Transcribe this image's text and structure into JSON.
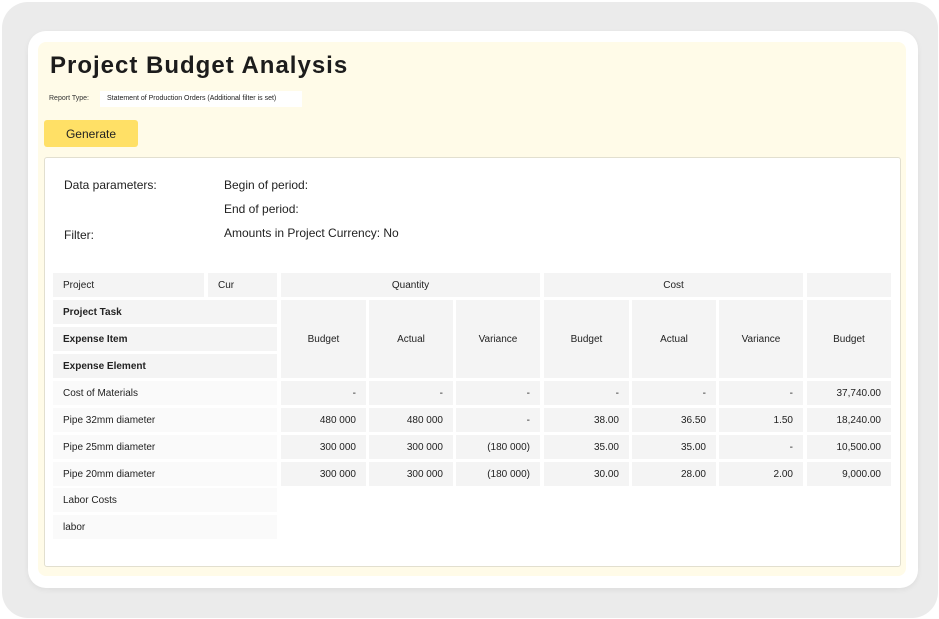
{
  "title": "Project Budget Analysis",
  "report_type": {
    "label": "Report Type:",
    "value": "Statement of Production Orders (Additional filter is set)"
  },
  "generate_label": "Generate",
  "parameters": {
    "data_parameters_label": "Data parameters:",
    "begin_label": "Begin of period:",
    "end_label": "End of period:",
    "filter_label": "Filter:",
    "amounts_label": "Amounts in Project Currency: No"
  },
  "table": {
    "header": {
      "project": "Project",
      "cur": "Cur",
      "quantity": "Quantity",
      "cost": "Cost",
      "extra": "",
      "project_task": "Project Task",
      "expense_item": "Expense Item",
      "expense_element": "Expense Element",
      "q_budget": "Budget",
      "q_actual": "Actual",
      "q_variance": "Variance",
      "c_budget": "Budget",
      "c_actual": "Actual",
      "c_variance": "Variance",
      "x_budget": "Budget"
    },
    "rows": [
      {
        "name": "Cost of Materials",
        "q_budget": "-",
        "q_actual": "-",
        "q_variance": "-",
        "c_budget": "-",
        "c_actual": "-",
        "c_variance": "-",
        "x_budget": "37,740.00"
      },
      {
        "name": "Pipe 32mm diameter",
        "q_budget": "480 000",
        "q_actual": "480 000",
        "q_variance": "-",
        "c_budget": "38.00",
        "c_actual": "36.50",
        "c_variance": "1.50",
        "x_budget": "18,240.00"
      },
      {
        "name": "Pipe 25mm diameter",
        "q_budget": "300 000",
        "q_actual": "300 000",
        "q_variance": "(180 000)",
        "c_budget": "35.00",
        "c_actual": "35.00",
        "c_variance": "-",
        "x_budget": "10,500.00"
      },
      {
        "name": "Pipe 20mm diameter",
        "q_budget": "300 000",
        "q_actual": "300 000",
        "q_variance": "(180 000)",
        "c_budget": "30.00",
        "c_actual": "28.00",
        "c_variance": "2.00",
        "x_budget": "9,000.00"
      },
      {
        "name": "Labor Costs"
      },
      {
        "name": "labor"
      }
    ]
  }
}
